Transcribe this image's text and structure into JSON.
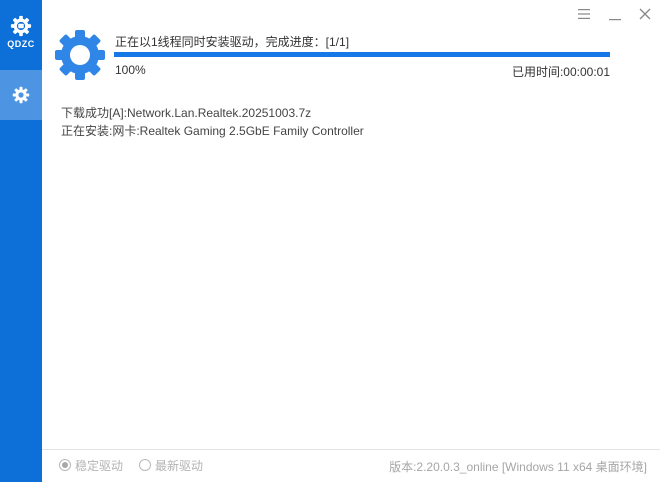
{
  "app": {
    "logo_text": "QDZC"
  },
  "sidebar": {
    "items": [
      {
        "icon": "gear-icon"
      }
    ]
  },
  "window_controls": {
    "menu_icon": "menu-icon",
    "minimize_icon": "minimize-icon",
    "close_icon": "close-icon"
  },
  "status": {
    "message": "正在以1线程同时安装驱动，完成进度：[1/1]",
    "progress_percent": 100,
    "percent_label": "100%",
    "elapsed": "已用时间:00:00:01"
  },
  "log": [
    "下载成功[A]:Network.Lan.Realtek.20251003.7z",
    "正在安装:网卡:Realtek Gaming 2.5GbE Family Controller"
  ],
  "footer": {
    "options": [
      {
        "label": "稳定驱动",
        "selected": true
      },
      {
        "label": "最新驱动",
        "selected": false
      }
    ],
    "version": "版本:2.20.0.3_online [Windows 11 x64 桌面环境]"
  },
  "colors": {
    "sidebar": "#0d6fd8",
    "sidebar_active": "#4d95e3",
    "accent": "#1678e6",
    "gear": "#2f86e6"
  }
}
